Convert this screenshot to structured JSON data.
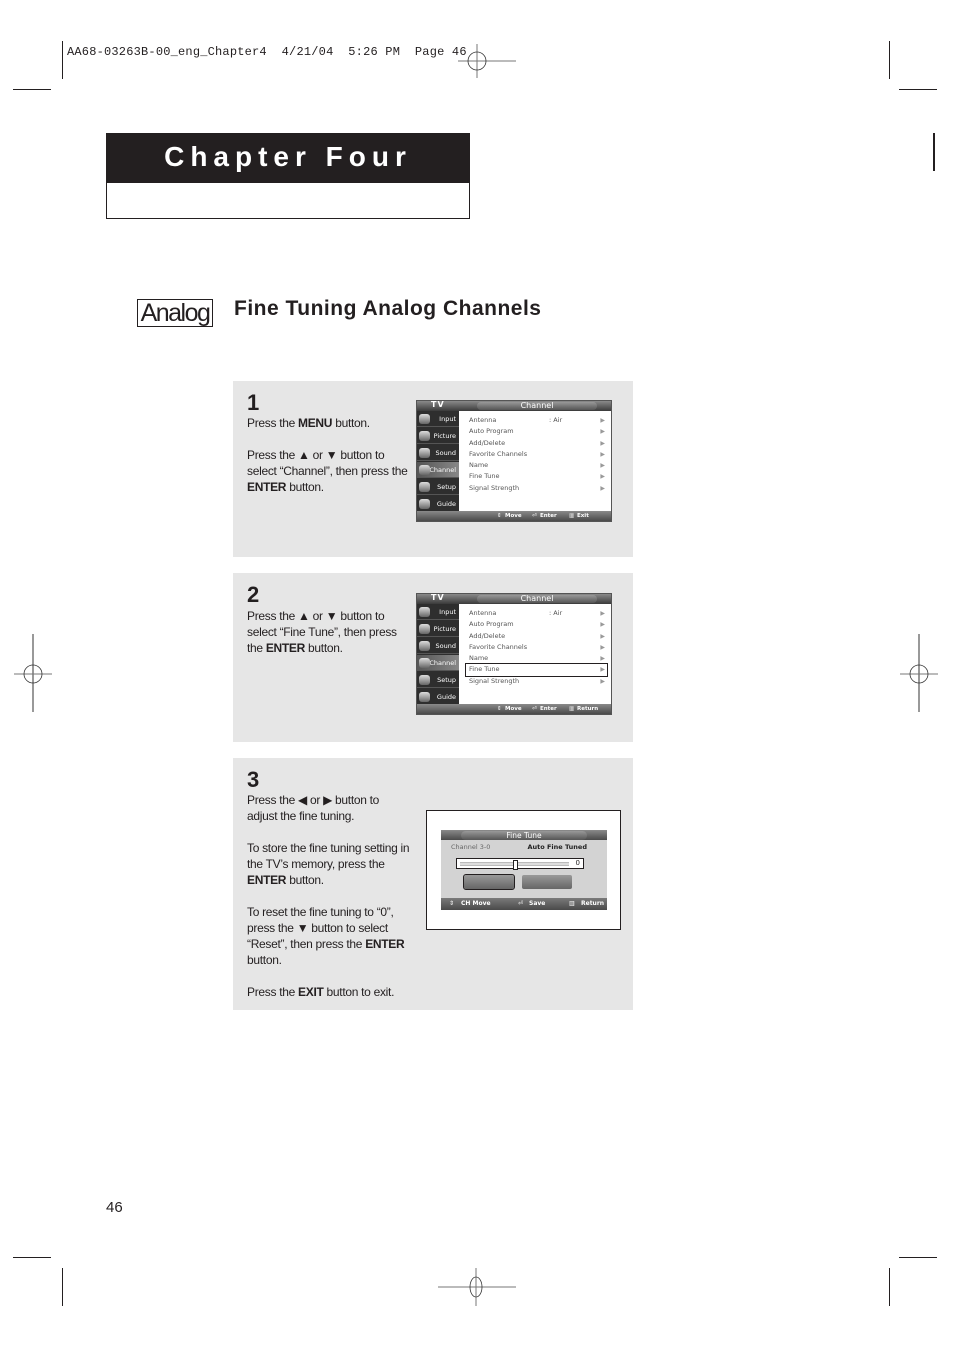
{
  "slug": {
    "file": "AA68-03263B-00_eng_Chapter4",
    "date": "4/21/04",
    "time": "5:26 PM",
    "page_label": "Page 46"
  },
  "chapter": {
    "title": "Chapter Four"
  },
  "section": {
    "badge": "Analog",
    "title": "Fine Tuning Analog Channels"
  },
  "steps": [
    {
      "number": "1",
      "paragraphs": [
        [
          "Press the ",
          {
            "b": "MENU"
          },
          " button."
        ],
        [
          "Press the ▲ or ▼ button to select “Channel”, then press the ",
          {
            "b": "ENTER"
          },
          " button."
        ]
      ]
    },
    {
      "number": "2",
      "paragraphs": [
        [
          "Press the ▲ or ▼ button to select “Fine Tune”, then press the ",
          {
            "b": "ENTER"
          },
          " button."
        ]
      ]
    },
    {
      "number": "3",
      "paragraphs": [
        [
          "Press the ◀ or ▶ button to adjust the fine tuning."
        ],
        [
          "To store the fine tuning setting in the TV’s memory, press the ",
          {
            "b": "ENTER"
          },
          " button."
        ],
        [
          "To reset the fine tuning to “0”, press the ▼ button to select “Reset”, then press the ",
          {
            "b": "ENTER"
          },
          " button."
        ],
        [
          "Press the ",
          {
            "b": "EXIT"
          },
          " button to exit."
        ]
      ]
    }
  ],
  "osd_menu": {
    "source": "TV",
    "title": "Channel",
    "sidebar": [
      "Input",
      "Picture",
      "Sound",
      "Channel",
      "Setup",
      "Guide"
    ],
    "sidebar_selected": "Channel",
    "items": [
      {
        "label": "Antenna",
        "value": ":  Air"
      },
      {
        "label": "Auto Program",
        "value": ""
      },
      {
        "label": "Add/Delete",
        "value": ""
      },
      {
        "label": "Favorite Channels",
        "value": ""
      },
      {
        "label": "Name",
        "value": ""
      },
      {
        "label": "Fine Tune",
        "value": ""
      },
      {
        "label": "Signal Strength",
        "value": ""
      }
    ],
    "arrow": "▶",
    "screen1_footer": [
      "Move",
      "Enter",
      "Exit"
    ],
    "screen2_footer": [
      "Move",
      "Enter",
      "Return"
    ],
    "screen2_highlight": "Fine Tune"
  },
  "fine_tune_osd": {
    "title": "Fine Tune",
    "channel": "Channel 3-0",
    "status": "Auto Fine Tuned",
    "value": "0",
    "slider_fraction": 0.5,
    "footer": [
      "CH Move",
      "Save",
      "Return"
    ]
  },
  "page_number": "46"
}
